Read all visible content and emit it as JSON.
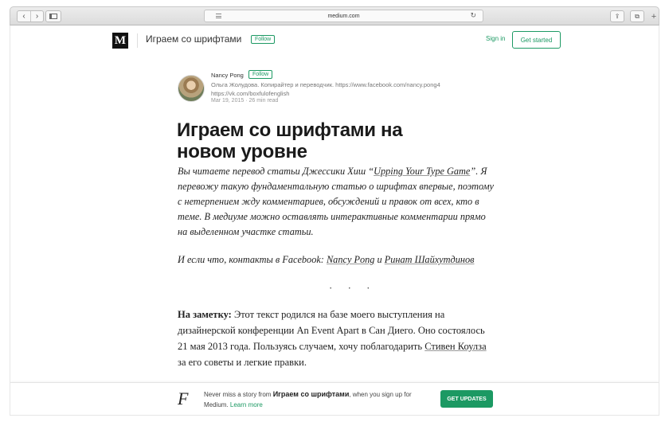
{
  "browser": {
    "url": "medium.com",
    "back_icon": "chevron-left",
    "forward_icon": "chevron-right",
    "newtab_symbol": "+"
  },
  "header": {
    "logo": "M",
    "publication_title": "Играем со шрифтами",
    "follow_label": "Follow",
    "signin_label": "Sign in",
    "getstarted_label": "Get started"
  },
  "author": {
    "name": "Nancy Pong",
    "follow_label": "Follow",
    "bio": "Ольга Жолудова. Копирайтер и переводчик. https://www.facebook.com/nancy.pong4 https://vk.com/boxfulofenglish",
    "date": "Mar 19, 2015",
    "read_time": "26 min read"
  },
  "article": {
    "title": "Играем со шрифтами на новом уровне",
    "lead_part1": "Вы читаете перевод статьи Джессики Хиш “",
    "lead_link": "Upping Your Type Game",
    "lead_part2": "”. Я перевожу такую фундаментальную статью о шрифтах впервые, поэтому с нетерпением жду комментариев, обсуждений и правок от всех, кто в теме. В медиуме можно оставлять интерактивные комментарии прямо на выделенном участке статьи.",
    "contacts_prefix": "И если что, контакты в Facebook: ",
    "contact1": "Nancy Pong",
    "contacts_and": " и ",
    "contact2": "Ринат Шайхутдинов",
    "separator": "· · ·",
    "note_label": "На заметку:",
    "note_text": " Этот текст родился на базе моего выступления на дизайнерской конференции An Event Apart в Сан Диего. Оно состоялось 21 мая 2013 года. Пользуясь случаем, хочу поблагодарить ",
    "note_link": "Стивен Коулза",
    "note_end": " за его советы и легкие правки."
  },
  "banner": {
    "logo": "F",
    "text_prefix": "Never miss a story from ",
    "publication": "Играем со шрифтами",
    "text_suffix": ", when you sign up for Medium. ",
    "learn_more": "Learn more",
    "button_label": "GET UPDATES"
  },
  "colors": {
    "accent": "#1c9963"
  }
}
